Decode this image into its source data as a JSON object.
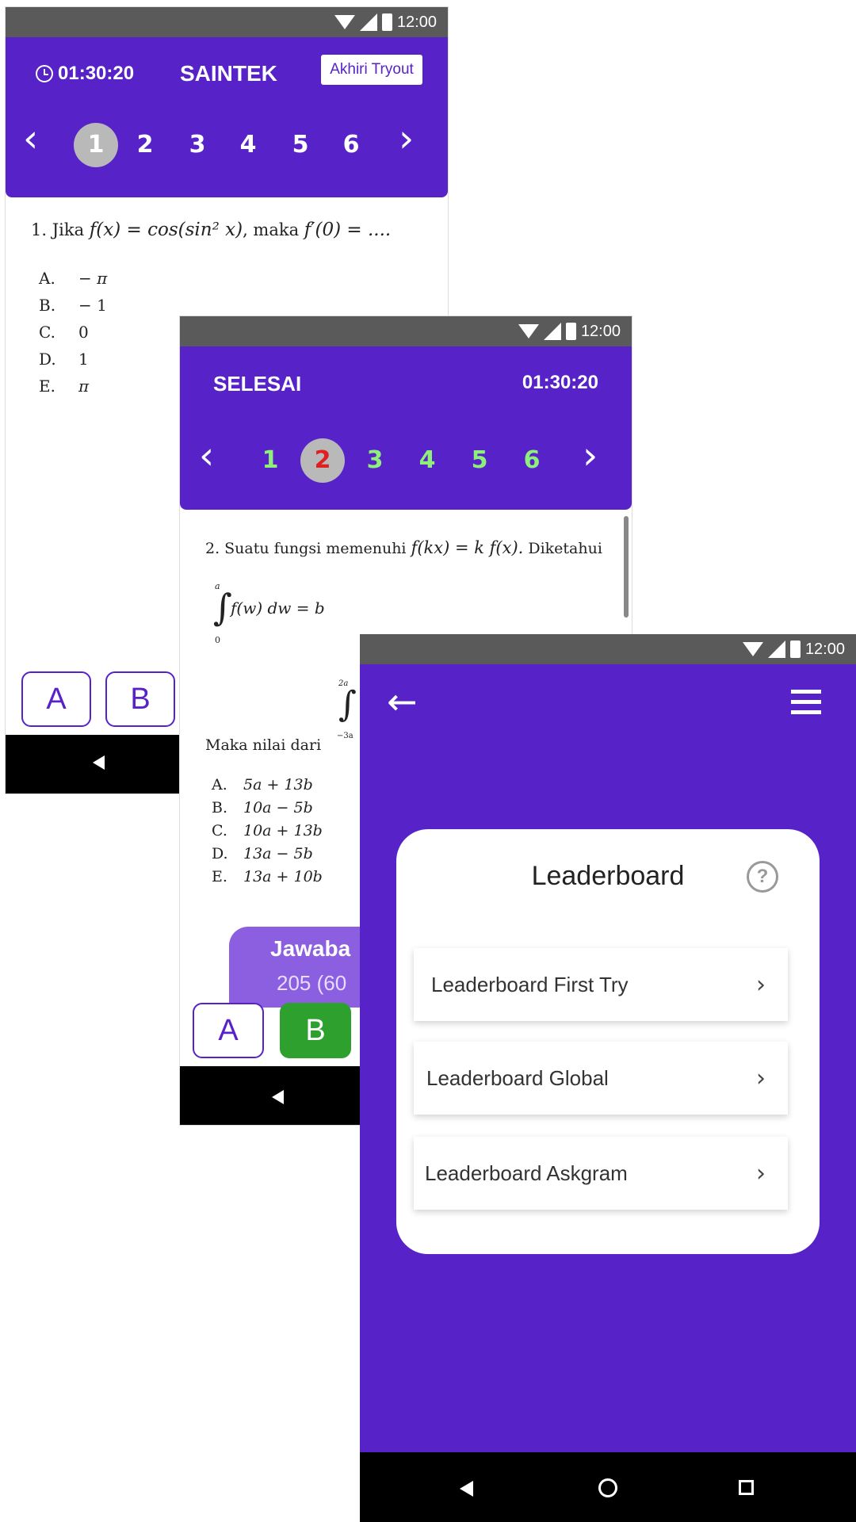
{
  "status_time": "12:00",
  "screen1": {
    "timer": "01:30:20",
    "title": "SAINTEK",
    "end_button": "Akhiri Tryout",
    "numbers": [
      "1",
      "2",
      "3",
      "4",
      "5",
      "6"
    ],
    "question_prefix": "1. Jika",
    "question_expr1": "f(x) = cos(sin² x)",
    "question_mid": ", maka",
    "question_expr2": "f′(0) = ....",
    "options": [
      {
        "letter": "A.",
        "value": "− π"
      },
      {
        "letter": "B.",
        "value": "− 1"
      },
      {
        "letter": "C.",
        "value": "0"
      },
      {
        "letter": "D.",
        "value": "1"
      },
      {
        "letter": "E.",
        "value": "π"
      }
    ],
    "answer_buttons": [
      "A",
      "B"
    ]
  },
  "screen2": {
    "title": "SELESAI",
    "timer": "01:30:20",
    "numbers": [
      "1",
      "2",
      "3",
      "4",
      "5",
      "6"
    ],
    "question_prefix": "2. Suatu fungsi memenuhi",
    "question_expr": "f(kx) = k f(x).",
    "question_suffix": "Diketahui",
    "integral_upper": "a",
    "integral_lower": "0",
    "integral_expr": "f(w) dw = b",
    "integral2_upper": "2a",
    "integral2_lower": "−3a",
    "maka_text": "Maka nilai dari",
    "options": [
      {
        "letter": "A.",
        "value": "5a + 13b"
      },
      {
        "letter": "B.",
        "value": "10a − 5b"
      },
      {
        "letter": "C.",
        "value": "10a + 13b"
      },
      {
        "letter": "D.",
        "value": "13a − 5b"
      },
      {
        "letter": "E.",
        "value": "13a + 10b"
      }
    ],
    "answer_title": "Jawaba",
    "answer_stats": "205 (60",
    "answer_buttons": [
      "A",
      "B"
    ],
    "colors": {
      "numbers": "#8ef07a",
      "active": "#e02020",
      "correct_button": "#2ea02e"
    }
  },
  "screen3": {
    "card_title": "Leaderboard",
    "items": [
      "Leaderboard First Try",
      "Leaderboard Global",
      "Leaderboard Askgram"
    ]
  }
}
